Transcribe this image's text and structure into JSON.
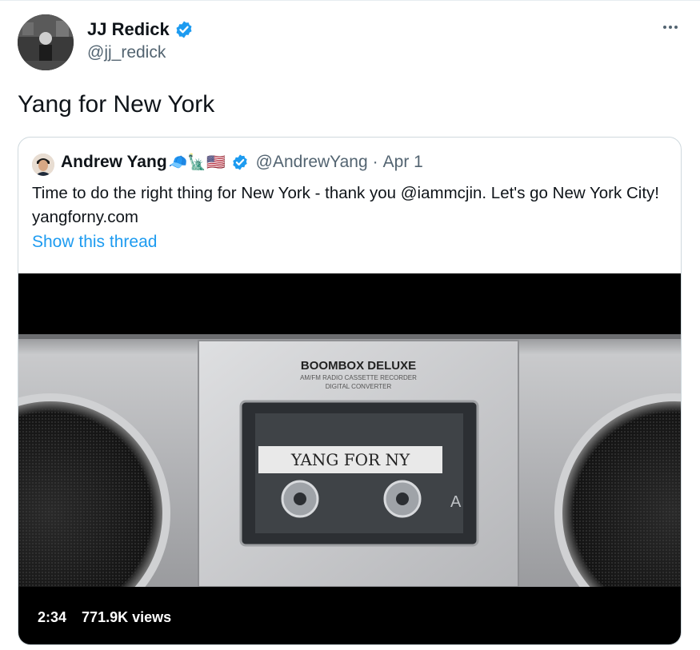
{
  "tweet": {
    "author": {
      "name": "JJ Redick",
      "handle": "@jj_redick",
      "verified": true
    },
    "text": "Yang for New York",
    "more_icon": "more-horizontal-icon"
  },
  "quoted_tweet": {
    "author": {
      "name": "Andrew Yang",
      "emoji": "🧢🗽🇺🇸",
      "handle": "@AndrewYang",
      "verified": true
    },
    "separator": "·",
    "date": "Apr 1",
    "text": "Time to do the right thing for New York - thank you @iammcjin.  Let's go New York City!  yangforny.com",
    "show_thread": "Show this thread",
    "video": {
      "brand": "BOOMBOX DELUXE",
      "sub1": "AM/FM RADIO CASSETTE RECORDER",
      "sub2": "DIGITAL CONVERTER",
      "tape_label": "YANG FOR NY",
      "side": "A",
      "duration": "2:34",
      "views": "771.9K views"
    }
  },
  "colors": {
    "link": "#1d9bf0",
    "verified": "#1d9bf0",
    "secondary_text": "#536471",
    "border": "#cfd9de"
  }
}
